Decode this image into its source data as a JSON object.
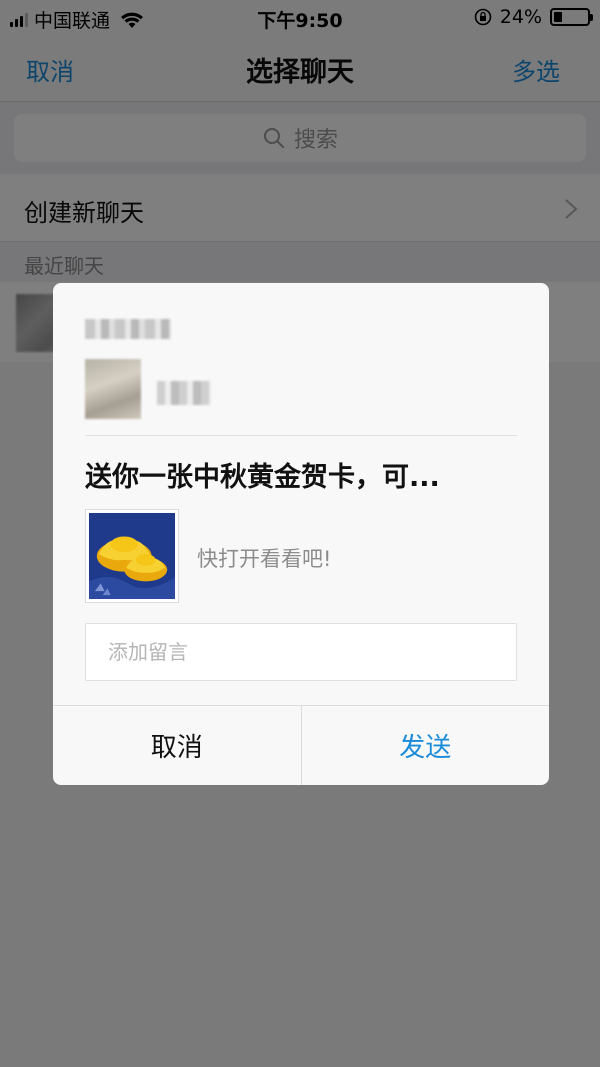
{
  "status_bar": {
    "carrier": "中国联通",
    "time": "下午9:50",
    "battery": "24%",
    "battery_level": 0.24,
    "signal_bars": 3,
    "icons": [
      "signal-icon",
      "wifi-icon",
      "rotation-lock-icon",
      "battery-icon"
    ]
  },
  "nav": {
    "left_label": "取消",
    "title": "选择聊天",
    "right_label": "多选"
  },
  "search": {
    "placeholder": "搜索"
  },
  "list": {
    "create_new_label": "创建新聊天",
    "section_header": "最近聊天"
  },
  "dialog": {
    "message_title": "送你一张中秋黄金贺卡，可...",
    "message_desc": "快打开看看吧!",
    "note_placeholder": "添加留言",
    "cancel_label": "取消",
    "send_label": "发送"
  },
  "colors": {
    "accent": "#1a8bd8",
    "overlay": "rgba(0,0,0,0.5)",
    "thumb_bg": "#1f3a8a",
    "gold": "#f5c518"
  }
}
